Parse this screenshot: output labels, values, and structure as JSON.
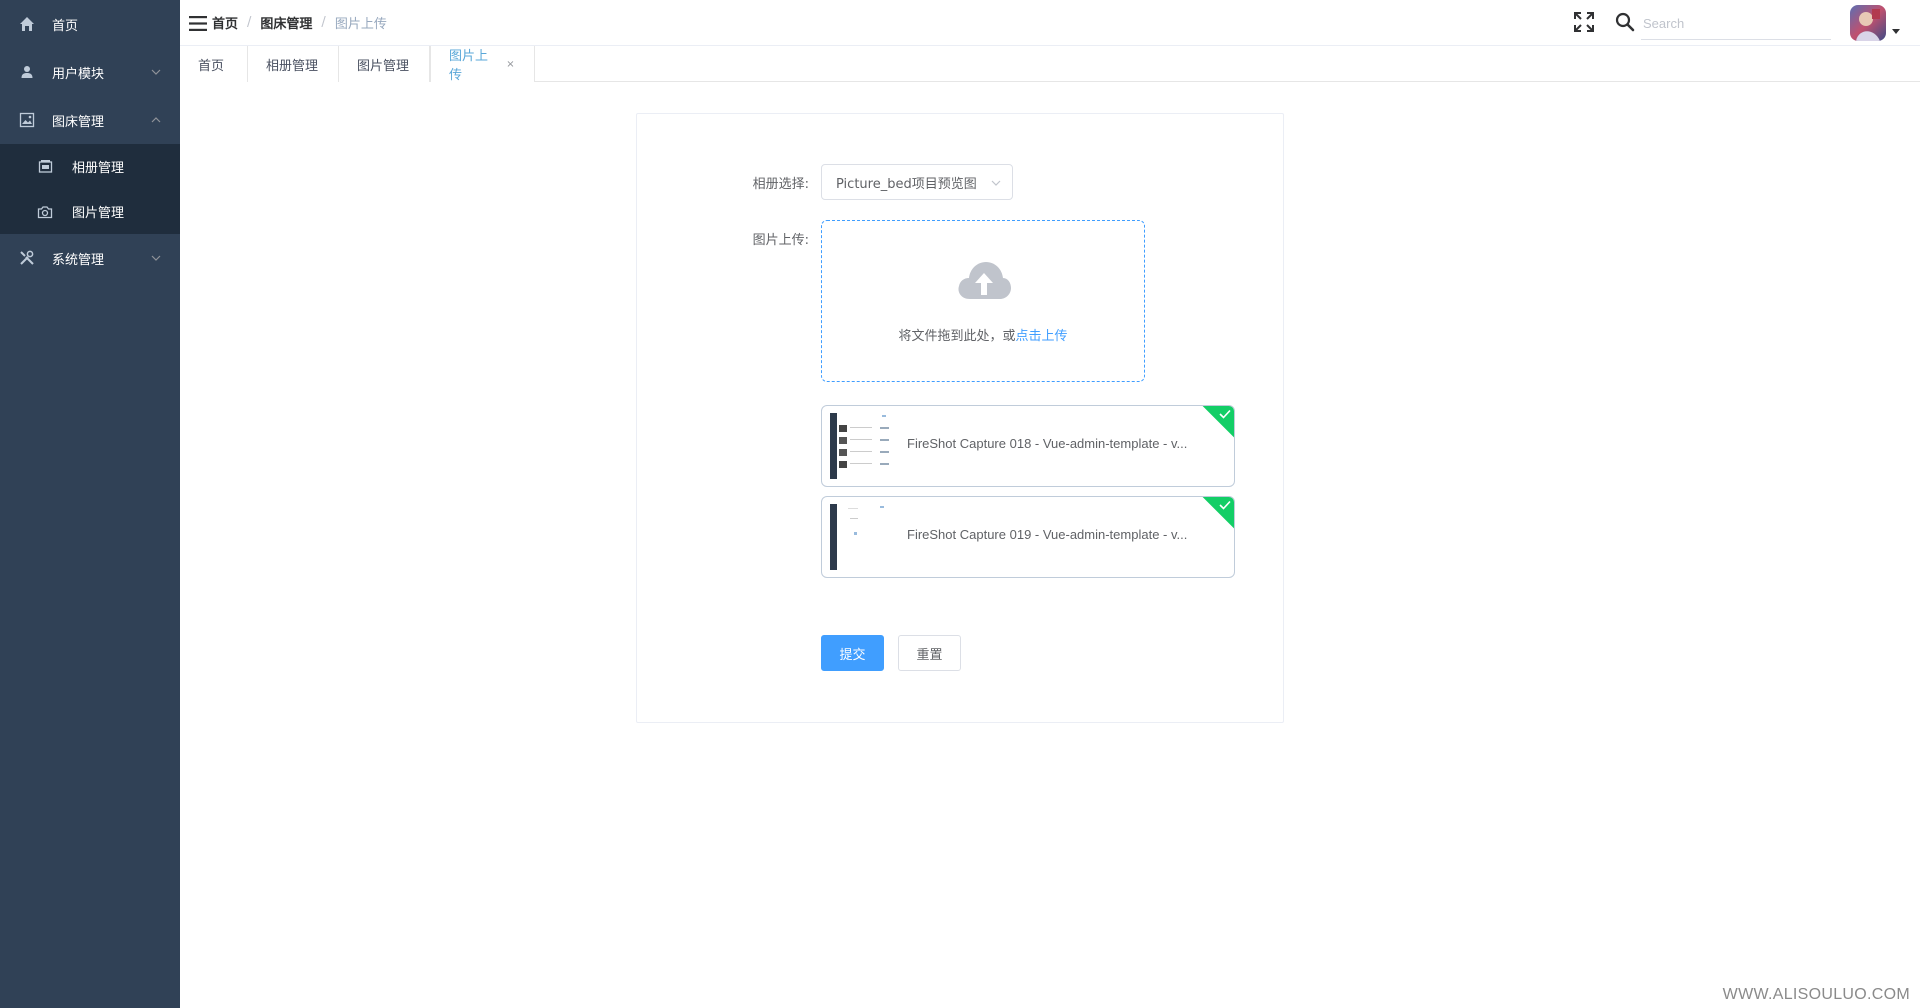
{
  "sidebar": {
    "items": [
      {
        "label": "首页"
      },
      {
        "label": "用户模块"
      },
      {
        "label": "图床管理"
      },
      {
        "label": "系统管理"
      }
    ],
    "submenu": [
      {
        "label": "相册管理"
      },
      {
        "label": "图片管理"
      }
    ]
  },
  "navbar": {
    "breadcrumb": [
      "首页",
      "图床管理",
      "图片上传"
    ],
    "breadcrumb_separator": "/",
    "search_placeholder": "Search"
  },
  "tags": [
    {
      "label": "首页"
    },
    {
      "label": "相册管理"
    },
    {
      "label": "图片管理"
    },
    {
      "label": "图片上传",
      "close": "×"
    }
  ],
  "form": {
    "album_label": "相册选择:",
    "album_value": "Picture_bed项目预览图",
    "upload_label": "图片上传:",
    "dropzone_text": "将文件拖到此处，或",
    "dropzone_link": "点击上传",
    "files": [
      {
        "name": "FireShot Capture 018 - Vue-admin-template - v..."
      },
      {
        "name": "FireShot Capture 019 - Vue-admin-template - v..."
      }
    ],
    "submit_label": "提交",
    "reset_label": "重置"
  },
  "watermark": "WWW.ALISOULUO.COM",
  "colors": {
    "sidebar_bg": "#304156",
    "submenu_bg": "#1f2d3d",
    "primary": "#409eff",
    "success": "#13ce66",
    "active_tag": "#5aa7d8"
  }
}
